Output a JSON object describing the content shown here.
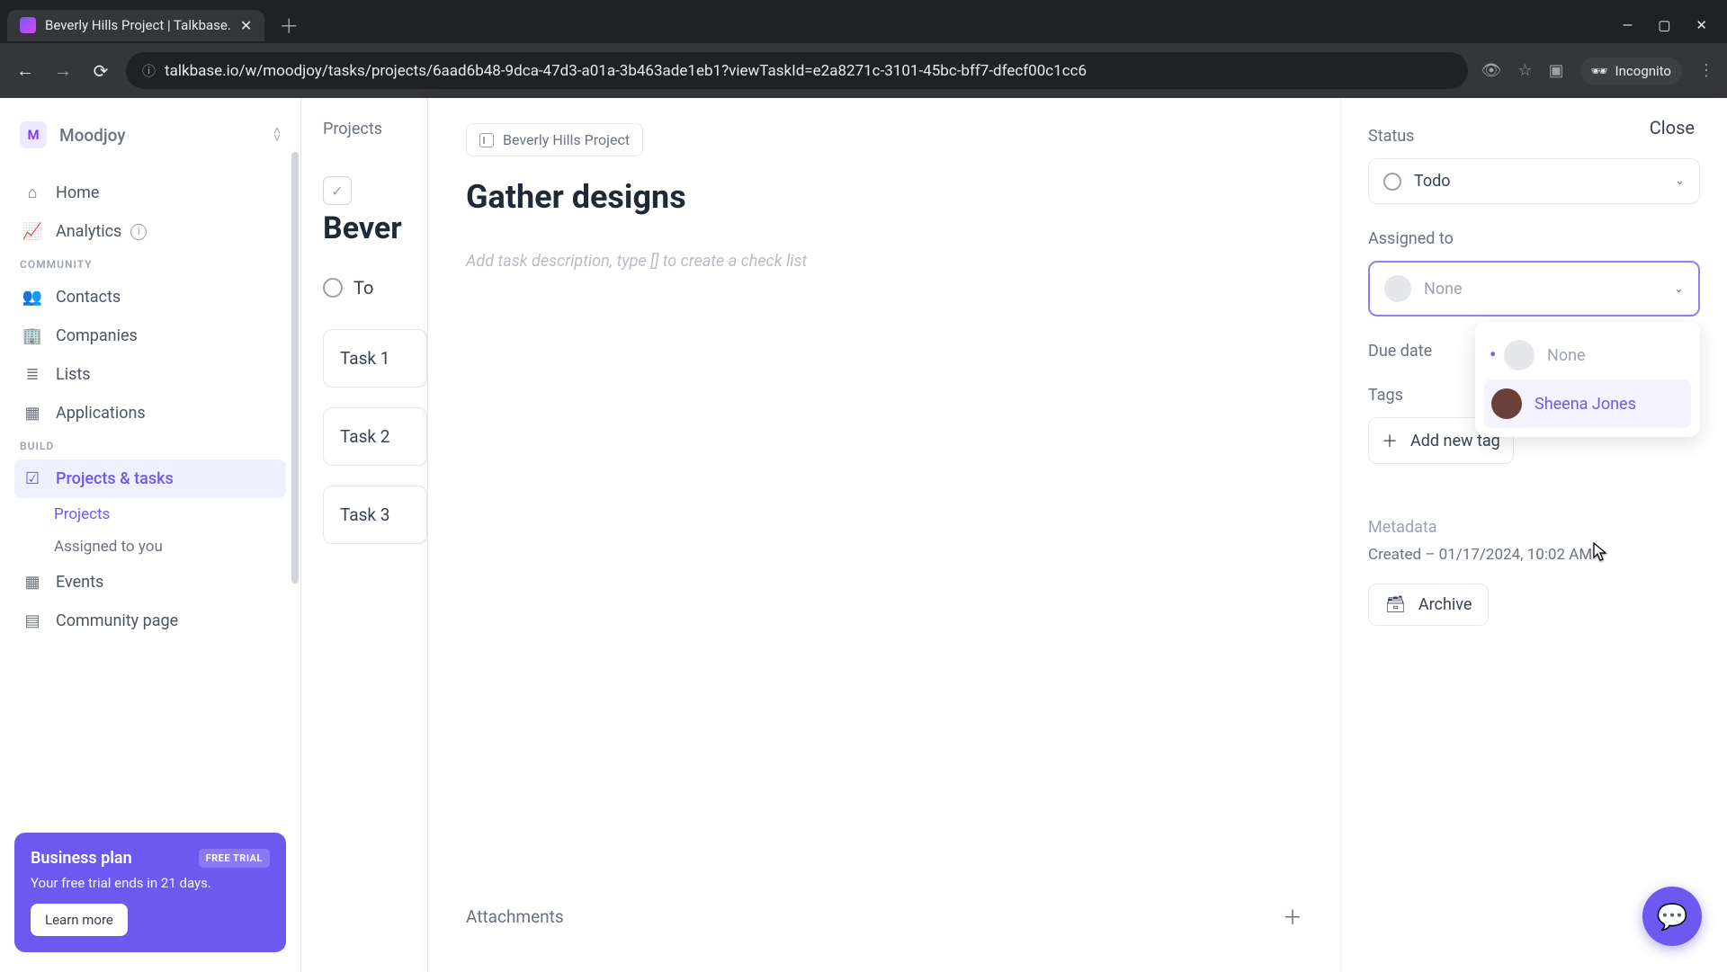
{
  "browser": {
    "tab_title": "Beverly Hills Project | Talkbase.",
    "url": "talkbase.io/w/moodjoy/tasks/projects/6aad6b48-9dca-47d3-a01a-3b463ade1eb1?viewTaskId=e2a8271c-3101-45bc-bff7-dfecf00c1cc6",
    "incognito": "Incognito"
  },
  "workspace": {
    "initial": "M",
    "name": "Moodjoy"
  },
  "nav": {
    "home": "Home",
    "analytics": "Analytics",
    "community_label": "COMMUNITY",
    "contacts": "Contacts",
    "companies": "Companies",
    "lists": "Lists",
    "applications": "Applications",
    "build_label": "BUILD",
    "projects_tasks": "Projects & tasks",
    "projects": "Projects",
    "assigned": "Assigned to you",
    "events": "Events",
    "community_page": "Community page"
  },
  "promo": {
    "title": "Business plan",
    "badge": "FREE TRIAL",
    "text": "Your free trial ends in 21 days.",
    "button": "Learn more"
  },
  "main": {
    "breadcrumb": "Projects",
    "project_title": "Bever",
    "column_status": "To",
    "tasks": [
      "Task 1",
      "Task 2",
      "Task 3"
    ]
  },
  "panel": {
    "close": "Close",
    "project_chip": "Beverly Hills Project",
    "task_title": "Gather designs",
    "desc_placeholder": "Add task description, type [] to create a check list",
    "attachments": "Attachments"
  },
  "side": {
    "status_label": "Status",
    "status_value": "Todo",
    "assigned_label": "Assigned to",
    "assigned_value": "None",
    "dropdown": {
      "none": "None",
      "user": "Sheena Jones"
    },
    "due_label": "Due date",
    "tags_label": "Tags",
    "add_tag": "Add new tag",
    "metadata_label": "Metadata",
    "created": "Created – 01/17/2024, 10:02 AM",
    "archive": "Archive"
  }
}
